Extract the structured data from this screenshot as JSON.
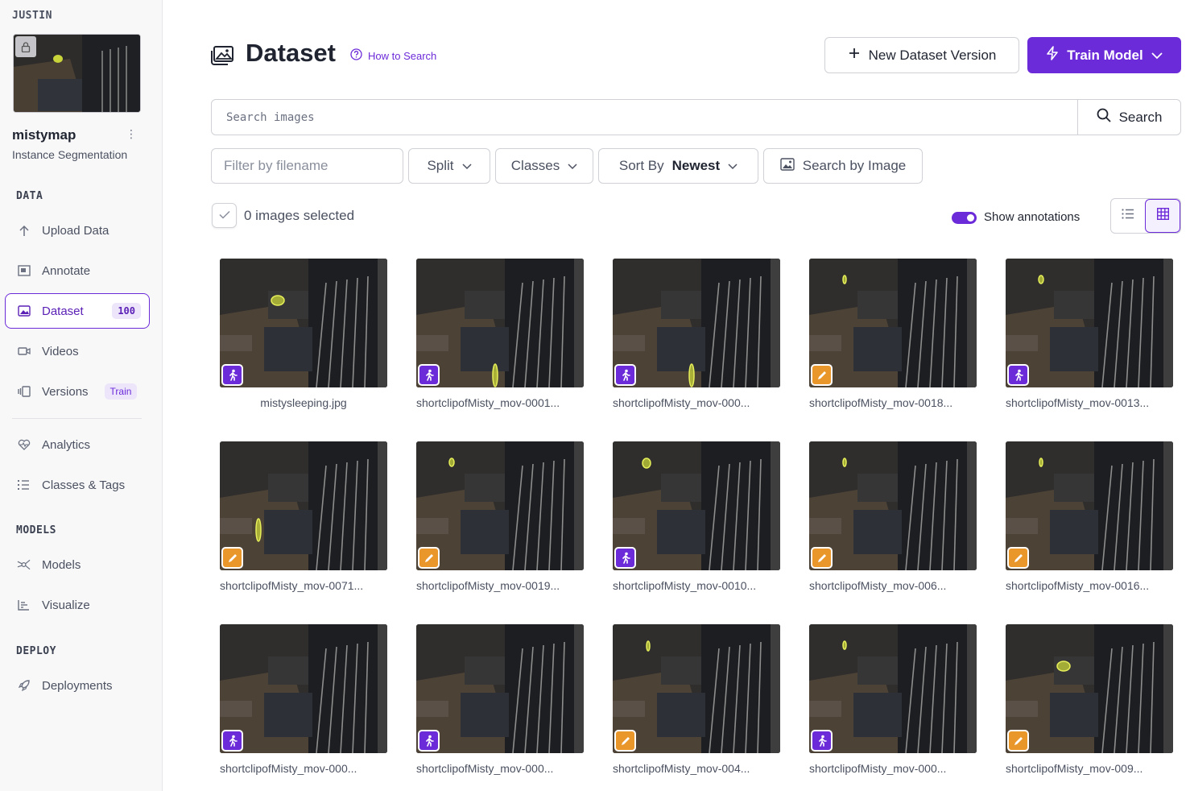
{
  "workspace": "JUSTIN",
  "project": {
    "name": "mistymap",
    "type": "Instance Segmentation"
  },
  "sidebar": {
    "sections": {
      "data": "DATA",
      "models": "MODELS",
      "deploy": "DEPLOY"
    },
    "items": [
      {
        "label": "Upload Data",
        "icon": "upload-icon"
      },
      {
        "label": "Annotate",
        "icon": "annotate-icon"
      },
      {
        "label": "Dataset",
        "icon": "dataset-icon",
        "badge": "100",
        "active": true
      },
      {
        "label": "Videos",
        "icon": "video-icon"
      },
      {
        "label": "Versions",
        "icon": "versions-icon",
        "badge": "Train"
      },
      {
        "label": "Analytics",
        "icon": "analytics-icon"
      },
      {
        "label": "Classes & Tags",
        "icon": "classes-icon"
      },
      {
        "label": "Models",
        "icon": "models-icon"
      },
      {
        "label": "Visualize",
        "icon": "visualize-icon"
      },
      {
        "label": "Deployments",
        "icon": "deployments-icon"
      }
    ]
  },
  "header": {
    "title": "Dataset",
    "how_to_search": "How to Search",
    "new_version": "New Dataset Version",
    "train_model": "Train Model"
  },
  "search": {
    "placeholder": "Search images",
    "button": "Search"
  },
  "filters": {
    "filename_placeholder": "Filter by filename",
    "split": "Split",
    "classes": "Classes",
    "sort_label": "Sort By",
    "sort_value": "Newest",
    "search_by_image": "Search by Image"
  },
  "selection": {
    "text": "0 images selected"
  },
  "annotations_toggle": {
    "label": "Show annotations",
    "on": true
  },
  "colors": {
    "accent": "#6c2bd9",
    "edit_tag": "#e9962b",
    "annotation": "#d4e04a"
  },
  "images": [
    {
      "name": "mistysleeping.jpg",
      "tag": "person"
    },
    {
      "name": "shortclipofMisty_mov-0001...",
      "tag": "person"
    },
    {
      "name": "shortclipofMisty_mov-000...",
      "tag": "person"
    },
    {
      "name": "shortclipofMisty_mov-0018...",
      "tag": "edit"
    },
    {
      "name": "shortclipofMisty_mov-0013...",
      "tag": "person"
    },
    {
      "name": "shortclipofMisty_mov-0071...",
      "tag": "edit"
    },
    {
      "name": "shortclipofMisty_mov-0019...",
      "tag": "edit"
    },
    {
      "name": "shortclipofMisty_mov-0010...",
      "tag": "person"
    },
    {
      "name": "shortclipofMisty_mov-006...",
      "tag": "edit"
    },
    {
      "name": "shortclipofMisty_mov-0016...",
      "tag": "edit"
    },
    {
      "name": "shortclipofMisty_mov-000...",
      "tag": "person"
    },
    {
      "name": "shortclipofMisty_mov-000...",
      "tag": "person"
    },
    {
      "name": "shortclipofMisty_mov-004...",
      "tag": "edit"
    },
    {
      "name": "shortclipofMisty_mov-000...",
      "tag": "person"
    },
    {
      "name": "shortclipofMisty_mov-009...",
      "tag": "edit"
    }
  ]
}
